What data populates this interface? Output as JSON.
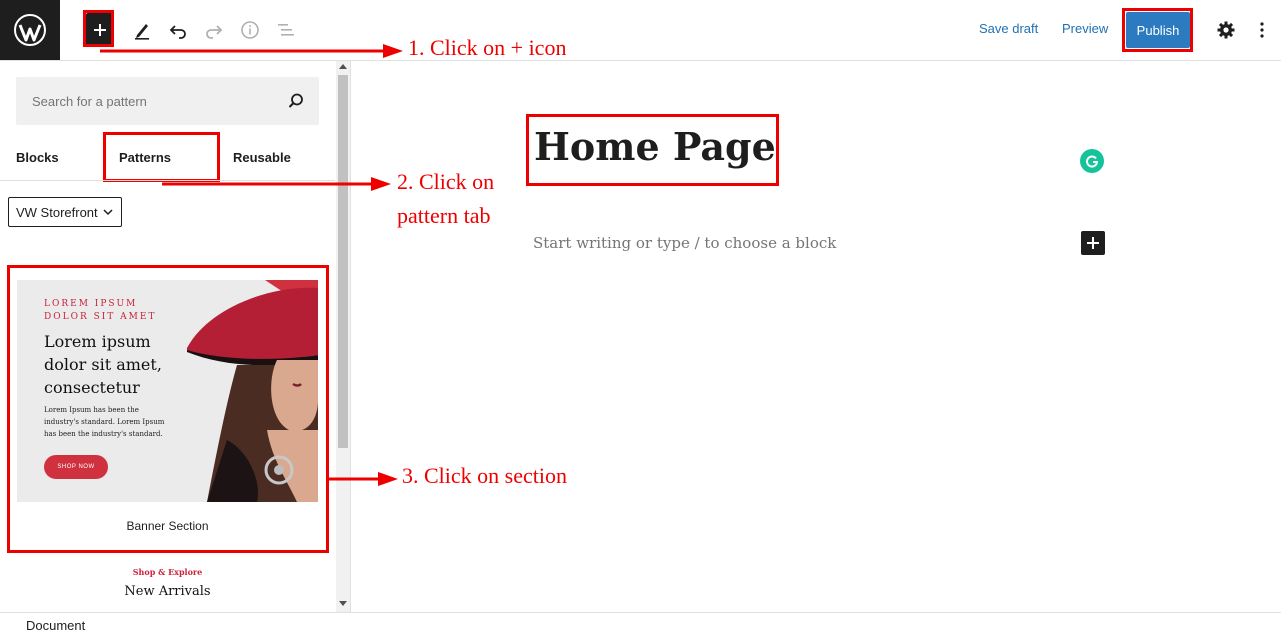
{
  "toolbar": {
    "save_draft": "Save draft",
    "preview": "Preview",
    "publish": "Publish"
  },
  "sidebar": {
    "search_placeholder": "Search for a pattern",
    "tabs": [
      "Blocks",
      "Patterns",
      "Reusable"
    ],
    "category_select": "VW Storefront",
    "pattern_card": {
      "preview": {
        "eyebrow": "LOREM IPSUM DOLOR SIT AMET",
        "heading": "Lorem ipsum dolor sit amet, consectetur",
        "body": "Lorem Ipsum has been the industry's standard. Lorem Ipsum has been the industry's standard.",
        "button": "SHOP NOW"
      },
      "label": "Banner Section"
    },
    "next_pattern": {
      "eyebrow": "Shop & Explore",
      "title": "New Arrivals"
    }
  },
  "editor": {
    "title": "Home Page",
    "placeholder": "Start writing or type / to choose a block"
  },
  "annotations": {
    "step1": "1. Click on + icon",
    "step2_line1": "2. Click on",
    "step2_line2": "pattern tab",
    "step3": "3. Click on section"
  },
  "footer": {
    "breadcrumb": "Document"
  },
  "colors": {
    "annotation_red": "#ee0000",
    "publish_blue": "#2c7bc1",
    "link_blue": "#2271b1",
    "brand_red": "#c9233a"
  }
}
